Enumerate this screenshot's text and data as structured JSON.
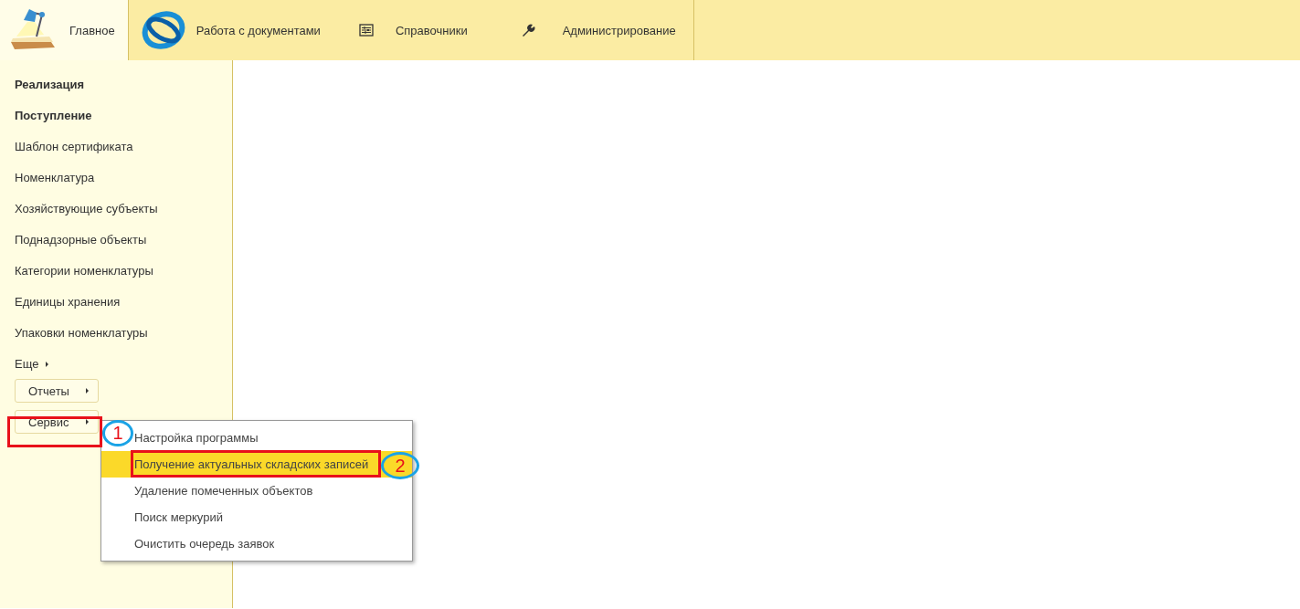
{
  "tabs": [
    {
      "label": "Главное",
      "selected": true,
      "kind": "lamp"
    },
    {
      "label": "Работа с документами",
      "selected": false,
      "kind": "logo"
    },
    {
      "label": "Справочники",
      "selected": false,
      "kind": "sliders"
    },
    {
      "label": "Администрирование",
      "selected": false,
      "kind": "wrench"
    }
  ],
  "sidebar": {
    "items": [
      {
        "label": "Реализация",
        "bold": true
      },
      {
        "label": "Поступление",
        "bold": true
      },
      {
        "label": "Шаблон сертификата",
        "bold": false
      },
      {
        "label": "Номенклатура",
        "bold": false
      },
      {
        "label": "Хозяйствующие субъекты",
        "bold": false
      },
      {
        "label": "Поднадзорные объекты",
        "bold": false
      },
      {
        "label": "Категории номенклатуры",
        "bold": false
      },
      {
        "label": "Единицы хранения",
        "bold": false
      },
      {
        "label": "Упаковки номенклатуры",
        "bold": false
      },
      {
        "label": "Еще",
        "bold": false
      }
    ],
    "buttons": [
      {
        "label": "Отчеты"
      },
      {
        "label": "Сервис"
      }
    ]
  },
  "menu": {
    "items": [
      {
        "label": "Настройка программы",
        "selected": false
      },
      {
        "label": "Получение актуальных складских записей",
        "selected": true
      },
      {
        "label": "Удаление помеченных объектов",
        "selected": false
      },
      {
        "label": "Поиск меркурий",
        "selected": false
      },
      {
        "label": "Очистить очередь заявок",
        "selected": false
      }
    ]
  },
  "annotations": [
    {
      "number": "1"
    },
    {
      "number": "2"
    }
  ]
}
